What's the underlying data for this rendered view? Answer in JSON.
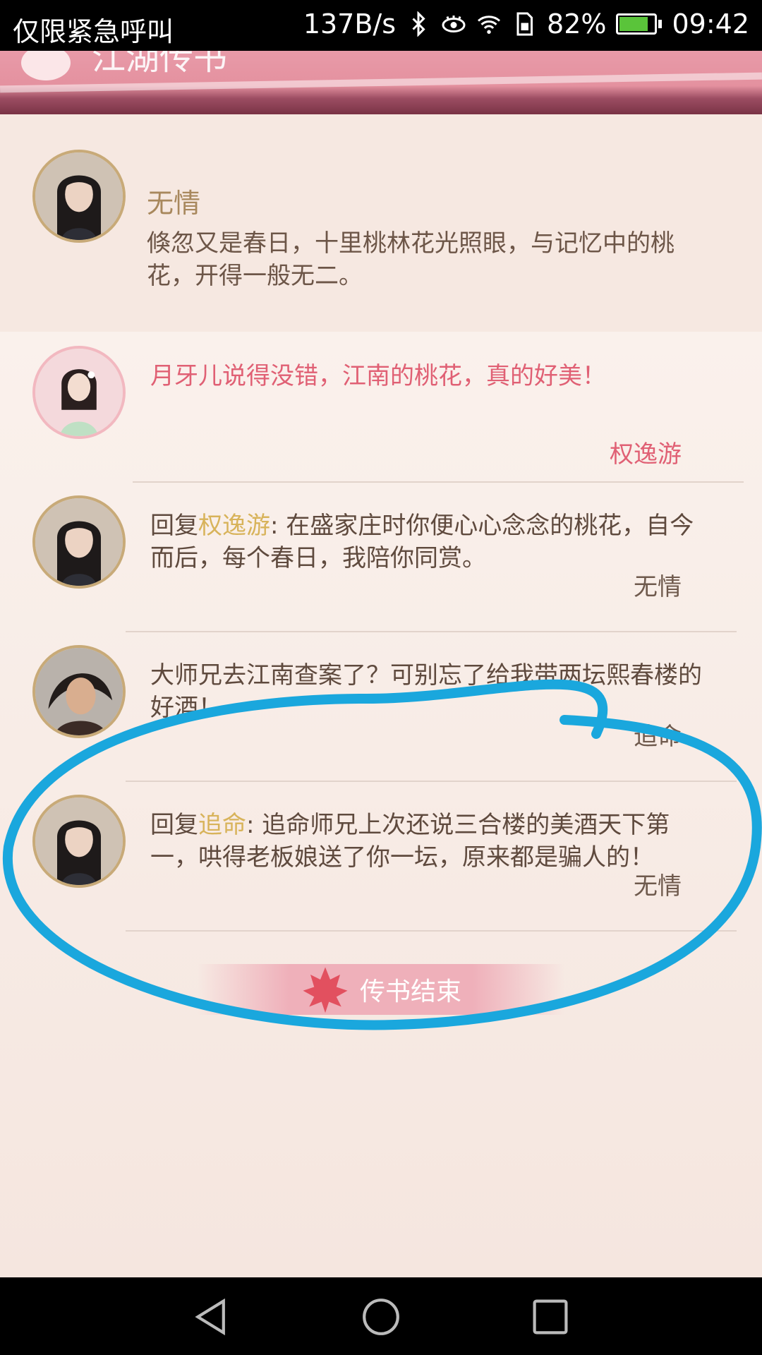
{
  "status_bar": {
    "carrier": "仅限紧急呼叫",
    "speed": "137B/s",
    "battery": "82%",
    "battery_level": 0.82,
    "time": "09:42"
  },
  "header": {
    "title": "江湖传书"
  },
  "post": {
    "author": "无情",
    "text": "倏忽又是春日，十里桃林花光照眼，与记忆中的桃花，开得一般无二。"
  },
  "comments": [
    {
      "text": "月牙儿说得没错，江南的桃花，真的好美！",
      "name": "权逸游"
    },
    {
      "reply_prefix": "回复",
      "reply_to": "权逸游",
      "text": ": 在盛家庄时你便心心念念的桃花，自今而后，每个春日，我陪你同赏。",
      "name": "无情"
    },
    {
      "text": "大师兄去江南查案了？可别忘了给我带两坛熙春楼的好酒！",
      "name": "追命"
    },
    {
      "reply_prefix": "回复",
      "reply_to": "追命",
      "text": ": 追命师兄上次还说三合楼的美酒天下第一，哄得老板娘送了你一坛，原来都是骗人的！",
      "name": "无情"
    }
  ],
  "end_label": "传书结束",
  "colors": {
    "accent_pink": "#e06074",
    "gold": "#d8b35a",
    "annotation_blue": "#1aa7dd"
  }
}
